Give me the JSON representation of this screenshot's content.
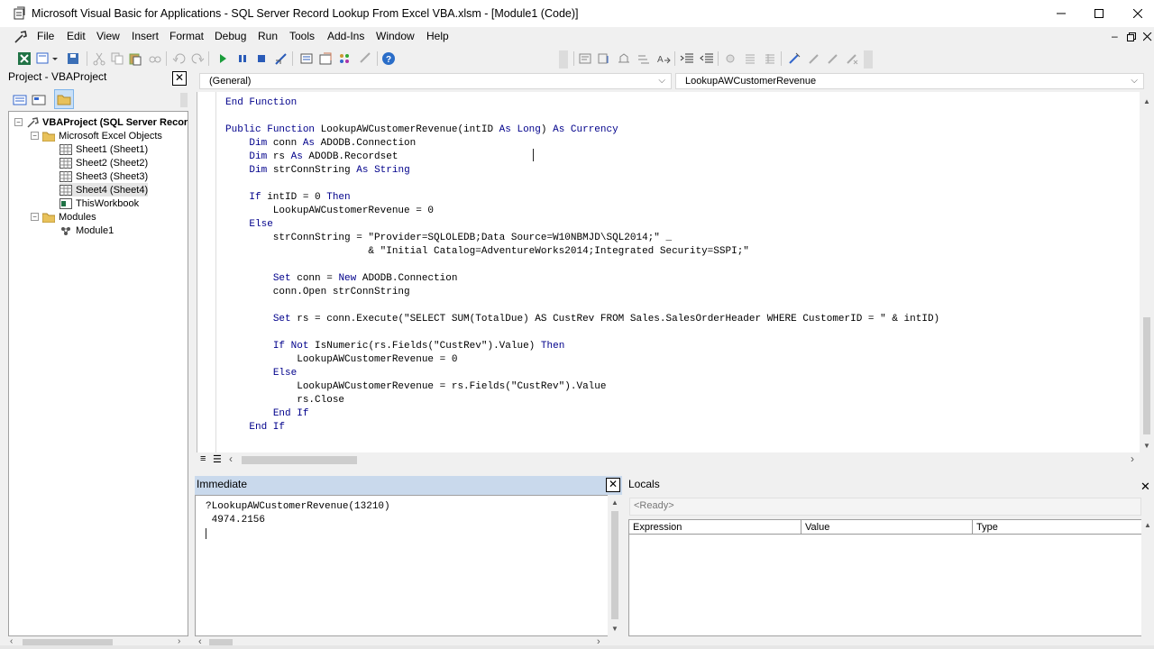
{
  "window": {
    "title": "Microsoft Visual Basic for Applications - SQL Server Record Lookup From Excel VBA.xlsm - [Module1 (Code)]"
  },
  "menu": [
    "File",
    "Edit",
    "View",
    "Insert",
    "Format",
    "Debug",
    "Run",
    "Tools",
    "Add-Ins",
    "Window",
    "Help"
  ],
  "project": {
    "title": "Project - VBAProject",
    "tree": {
      "root": "VBAProject (SQL Server Recor",
      "objects_folder": "Microsoft Excel Objects",
      "sheets": [
        "Sheet1 (Sheet1)",
        "Sheet2 (Sheet2)",
        "Sheet3 (Sheet3)",
        "Sheet4 (Sheet4)"
      ],
      "workbook": "ThisWorkbook",
      "modules_folder": "Modules",
      "module": "Module1"
    }
  },
  "code": {
    "object_combo": "(General)",
    "procedure_combo": "LookupAWCustomerRevenue",
    "lines": [
      "End Function",
      "",
      "Public Function LookupAWCustomerRevenue(intID As Long) As Currency",
      "    Dim conn As ADODB.Connection",
      "    Dim rs As ADODB.Recordset",
      "    Dim strConnString As String",
      "",
      "    If intID = 0 Then",
      "        LookupAWCustomerRevenue = 0",
      "    Else",
      "        strConnString = \"Provider=SQLOLEDB;Data Source=W10NBMJD\\SQL2014;\" _",
      "                        & \"Initial Catalog=AdventureWorks2014;Integrated Security=SSPI;\"",
      "",
      "        Set conn = New ADODB.Connection",
      "        conn.Open strConnString",
      "",
      "        Set rs = conn.Execute(\"SELECT SUM(TotalDue) AS CustRev FROM Sales.SalesOrderHeader WHERE CustomerID = \" & intID)",
      "",
      "        If Not IsNumeric(rs.Fields(\"CustRev\").Value) Then",
      "            LookupAWCustomerRevenue = 0",
      "        Else",
      "            LookupAWCustomerRevenue = rs.Fields(\"CustRev\").Value",
      "            rs.Close",
      "        End If",
      "    End If"
    ]
  },
  "immediate": {
    "title": "Immediate",
    "lines": [
      "?LookupAWCustomerRevenue(13210)",
      " 4974.2156"
    ]
  },
  "locals": {
    "title": "Locals",
    "status": "<Ready>",
    "columns": [
      "Expression",
      "Value",
      "Type"
    ]
  }
}
